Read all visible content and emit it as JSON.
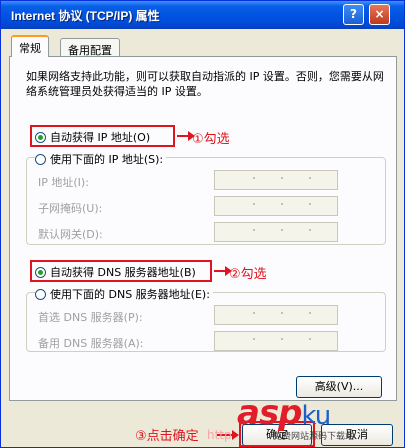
{
  "window": {
    "title": "Internet 协议 (TCP/IP) 属性",
    "help_glyph": "?",
    "close_glyph": "×"
  },
  "tabs": [
    {
      "label": "常规"
    },
    {
      "label": "备用配置"
    }
  ],
  "description": "如果网络支持此功能，则可以获取自动指派的 IP 设置。否则，您需要从网络系统管理员处获得适当的 IP 设置。",
  "ip_section": {
    "auto_label": "自动获得 IP 地址(O)",
    "manual_label": "使用下面的 IP 地址(S):",
    "fields": [
      {
        "label": "IP 地址(I):"
      },
      {
        "label": "子网掩码(U):"
      },
      {
        "label": "默认网关(D):"
      }
    ]
  },
  "dns_section": {
    "auto_label": "自动获得 DNS 服务器地址(B)",
    "manual_label": "使用下面的 DNS 服务器地址(E):",
    "fields": [
      {
        "label": "首选 DNS 服务器(P):"
      },
      {
        "label": "备用 DNS 服务器(A):"
      }
    ]
  },
  "advanced_button": "高级(V)...",
  "annotations": {
    "step1": "①勾选",
    "step2": "②勾选",
    "step3": "③点击确定"
  },
  "ok_button": "确定",
  "cancel_button": "取消",
  "watermark": {
    "brand": "asp",
    "ku": "ku",
    "sub": "免费网站源码下载站",
    "faint": "http"
  },
  "colors": {
    "titlebar": "#0054e3",
    "annotation": "#e0141e",
    "window_bg": "#ece9d8"
  }
}
